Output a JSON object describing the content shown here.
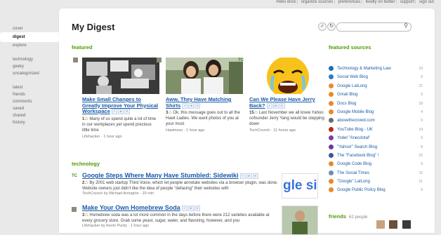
{
  "topbar": {
    "greeting": "Hello erick",
    "links": [
      "organize sources",
      "preferences",
      "feedly on twitter",
      "support",
      "sign out"
    ]
  },
  "sidebar": {
    "top": [
      "cover",
      "digest",
      "explore"
    ],
    "active": "digest",
    "categories": [
      "technology",
      "geeky",
      "uncategorized"
    ],
    "lists": [
      "latest",
      "friends",
      "comments",
      "saved",
      "shared",
      "history"
    ]
  },
  "page": {
    "title": "My Digest",
    "search_placeholder": ""
  },
  "featured": {
    "heading": "featured",
    "cards": [
      {
        "source_icon": "source-icon",
        "headline": "Make Small Changes to Greatly Improve Your Physical Workspace",
        "count": "1",
        "summary": "Many of us spend quite a lot of time in our workplaces yet spend precious little time",
        "source": "Lifehacker",
        "time": "1 hour ago"
      },
      {
        "source_icon": "source-icon",
        "headline": "Aww, They Have Matching Shirts",
        "count": "3",
        "summary": "Ok, this message goes out to all the Hawt Ladies. We want photos of you at your most",
        "source": "Hawtness",
        "time": "1 hour ago"
      },
      {
        "source_icon": "TC",
        "headline": "Can We Please Have Jerry Back?",
        "count": "15",
        "summary": "Last November we all knew Yahoo cofounder Jerry Yang would be stepping down",
        "source": "TechCrunch",
        "time": "11 hours ago"
      }
    ]
  },
  "technology": {
    "heading": "technology",
    "rows": [
      {
        "source_icon": "TC",
        "headline": "Google Steps Where Many Have Stumbled: Sidewiki",
        "count": "2",
        "summary": "By 2001 web startup Third Voice, which let people annotate websites via a browser plugin, was done. Website owners just didn't like the idea of people \"defacing\" their websites with",
        "source": "TechCrunch",
        "author": "by Michael Arrington",
        "time": "20 min"
      },
      {
        "source_icon": "source-icon",
        "headline": "Make Your Own Homebrew Soda",
        "count": "3",
        "summary": "Homebrew soda was a lot more common in the days before there were 212 varieties available at every grocery store. Grab some yeast, sugar, water, and flavoring, however, and you",
        "source": "Lifehacker",
        "author": "by Kevin Purdy",
        "time": "1 hour ago"
      }
    ]
  },
  "featured_sources": {
    "heading": "featured sources",
    "items": [
      {
        "name": "Technology & Marketing Law",
        "count": "10",
        "color": "#1c6fb8"
      },
      {
        "name": "Social Web Blog",
        "count": "9",
        "color": "#2b79c9"
      },
      {
        "name": "Google LatLong",
        "count": "21",
        "color": "#e78b2a"
      },
      {
        "name": "Gmail Blog",
        "count": "9",
        "color": "#e78b2a"
      },
      {
        "name": "Docs Blog",
        "count": "18",
        "color": "#e78b2a"
      },
      {
        "name": "Google Mobile Blog",
        "count": "4",
        "color": "#e78b2a"
      },
      {
        "name": "abovethecrowd.com",
        "count": "9",
        "color": "#6b6b6b"
      },
      {
        "name": "YouTube Blog - UK",
        "count": "14",
        "color": "#c0261b"
      },
      {
        "name": "Yodel \"Anecdotal\"",
        "count": "9",
        "color": "#7a3fa6"
      },
      {
        "name": "\"Yahoo!\" Search Blog",
        "count": "8",
        "color": "#6a3aa0"
      },
      {
        "name": "The \"Facebook Blog\" !",
        "count": "22",
        "color": "#3b5998"
      },
      {
        "name": "Google Code Blog",
        "count": "9",
        "color": "#e78b2a"
      },
      {
        "name": "The Social Times",
        "count": "16",
        "color": "#6f8fa6"
      },
      {
        "name": "\"Google\" LatLong",
        "count": "21",
        "color": "#e78b2a"
      },
      {
        "name": "Google Public Policy Blog",
        "count": "9",
        "color": "#e78b2a"
      }
    ]
  },
  "friends": {
    "heading": "friends",
    "count": "62 people"
  },
  "thumbnail_text": "gle sid"
}
